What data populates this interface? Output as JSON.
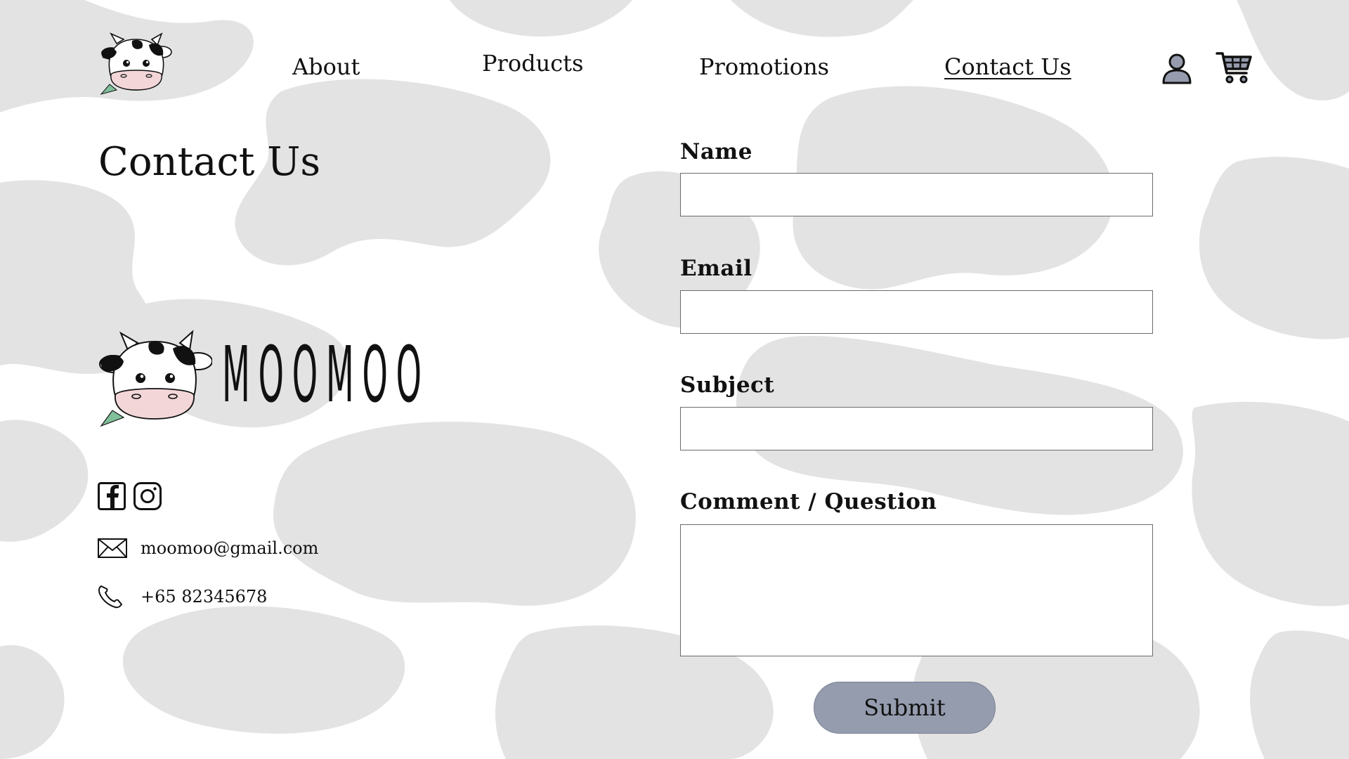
{
  "nav": {
    "links": [
      {
        "label": "About",
        "active": false
      },
      {
        "label": "Products",
        "active": false
      },
      {
        "label": "Promotions",
        "active": false
      },
      {
        "label": "Contact Us",
        "active": true
      }
    ],
    "account_icon": "user-icon",
    "cart_icon": "cart-icon"
  },
  "page": {
    "title": "Contact Us"
  },
  "brand": {
    "wordmark": "MOOMOO",
    "logo_icon": "cow-head-icon"
  },
  "social": {
    "facebook_icon": "facebook-icon",
    "instagram_icon": "instagram-icon"
  },
  "contact": {
    "email": "moomoo@gmail.com",
    "phone": "+65 82345678"
  },
  "form": {
    "name_label": "Name",
    "name_value": "",
    "email_label": "Email",
    "email_value": "",
    "subject_label": "Subject",
    "subject_value": "",
    "comment_label": "Comment / Question",
    "comment_value": "",
    "submit_label": "Submit"
  },
  "colors": {
    "background": "#ffffff",
    "cow_spots": "#e3e3e3",
    "submit_button": "#959cae",
    "icon_fill": "#969cae",
    "nose": "#f2d6d8",
    "leaf": "#7fbf9a"
  }
}
